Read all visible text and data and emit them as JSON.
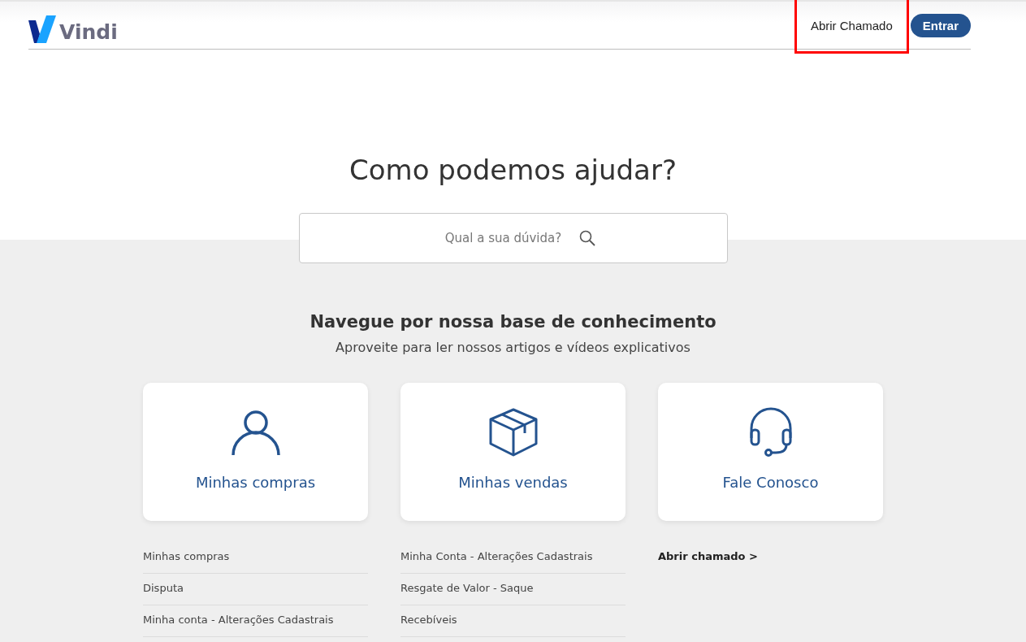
{
  "header": {
    "logo": "Vindi",
    "nav": [
      {
        "label": "Abrir Chamado",
        "kind": "link",
        "highlighted": true
      },
      {
        "label": "Entrar",
        "kind": "button"
      }
    ]
  },
  "hero": {
    "title": "Como podemos ajudar?",
    "search": {
      "placeholder": "Qual a sua dúvida?"
    }
  },
  "knowledge_base": {
    "title": "Navegue por nossa base de conhecimento",
    "subtitle": "Aproveite para ler nossos artigos e vídeos explicativos",
    "categories": [
      {
        "title": "Minhas compras",
        "kind": "person",
        "links": [
          {
            "label": "Minhas compras",
            "kind": "article"
          },
          {
            "label": "Disputa",
            "kind": "article"
          },
          {
            "label": "Minha conta - Alterações Cadastrais",
            "kind": "article"
          }
        ]
      },
      {
        "title": "Minhas vendas",
        "kind": "box",
        "links": [
          {
            "label": "Minha Conta - Alterações Cadastrais",
            "kind": "article"
          },
          {
            "label": "Resgate de Valor - Saque",
            "kind": "article"
          },
          {
            "label": "Recebíveis",
            "kind": "article"
          }
        ]
      },
      {
        "title": "Fale Conosco",
        "kind": "headset",
        "links": [
          {
            "label": "Abrir chamado >",
            "kind": "cta"
          }
        ]
      }
    ]
  }
}
